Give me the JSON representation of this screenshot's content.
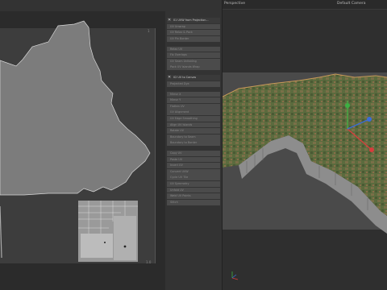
{
  "uv_editor": {
    "corner_top_right": "1",
    "corner_bottom_right": "1.0"
  },
  "operations": {
    "section_1": "01 UVW from Projection...",
    "group_1": [
      "UV Unwrap",
      "UV Relax & Pack",
      "UV Pin Border",
      "Relax UV",
      "Fix Overlaps",
      "UV Seam Unfolding",
      "Pack UV Islands Wrap"
    ],
    "section_2": "02 UV to Canvas",
    "section_2_sub": "Projected Dye",
    "group_2": [
      "Mirror X",
      "Mirror Y",
      "Flatten UV",
      "UV Alignment",
      "UV Edge Smoothing",
      "Align UV Islands",
      "Rotate UV",
      "Boundary to Seam",
      "Boundary to Border"
    ],
    "group_3": [
      "Copy UV",
      "Paste UV",
      "Invert UV",
      "Convert UVW",
      "Cycle UV Tile",
      "UV Symmetry",
      "Unfold UV",
      "Weld UV Points",
      "Stitch"
    ]
  },
  "viewport": {
    "title": "Perspective",
    "camera": "Default Camera"
  },
  "colors": {
    "panel_bg": "#2b2b2b",
    "uv_shape": "#7c7c7c",
    "terrain_green": "#5b6b3e",
    "terrain_brown": "#8a6e4a",
    "axis_red": "#d83c3c",
    "axis_green": "#3cb043",
    "axis_blue": "#3c6cd8"
  }
}
